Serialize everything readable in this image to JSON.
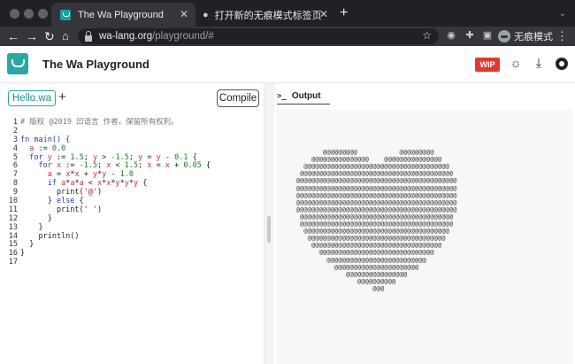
{
  "browser": {
    "tabs": [
      {
        "title": "The Wa Playground",
        "icon": "wa-favicon-icon"
      },
      {
        "title": "打开新的无痕模式标签页",
        "icon": "incognito-icon"
      }
    ],
    "url_host": "wa-lang.org",
    "url_path": "/playground/#",
    "profile_label": "无痕模式"
  },
  "app": {
    "title": "The Wa Playground",
    "badge": "WIP",
    "accent_color": "#27a9a3",
    "badge_color": "#e03a2f"
  },
  "editor": {
    "file_tab": "Hello.wa",
    "add_label": "+",
    "compile_label": "Compile",
    "code": [
      [
        {
          "t": "# 版权 @2019 凹语言 作者。保留所有权利。",
          "c": "cm"
        }
      ],
      [],
      [
        {
          "t": "fn main() {",
          "c": "kw"
        }
      ],
      [
        {
          "t": "  "
        },
        {
          "t": "a",
          "c": "vr"
        },
        {
          "t": " := "
        },
        {
          "t": "0.0",
          "c": "nm"
        }
      ],
      [
        {
          "t": "  for ",
          "c": "kw"
        },
        {
          "t": "y",
          "c": "vr"
        },
        {
          "t": " := "
        },
        {
          "t": "1.5",
          "c": "nm"
        },
        {
          "t": "; "
        },
        {
          "t": "y",
          "c": "vr"
        },
        {
          "t": " > "
        },
        {
          "t": "-1.5",
          "c": "nm"
        },
        {
          "t": "; "
        },
        {
          "t": "y",
          "c": "vr"
        },
        {
          "t": " = "
        },
        {
          "t": "y",
          "c": "vr"
        },
        {
          "t": " - "
        },
        {
          "t": "0.1",
          "c": "nm"
        },
        {
          "t": " {"
        }
      ],
      [
        {
          "t": "    for ",
          "c": "kw"
        },
        {
          "t": "x",
          "c": "vr"
        },
        {
          "t": " := "
        },
        {
          "t": "-1.5",
          "c": "nm"
        },
        {
          "t": "; "
        },
        {
          "t": "x",
          "c": "vr"
        },
        {
          "t": " < "
        },
        {
          "t": "1.5",
          "c": "nm"
        },
        {
          "t": "; "
        },
        {
          "t": "x",
          "c": "vr"
        },
        {
          "t": " = "
        },
        {
          "t": "x",
          "c": "vr"
        },
        {
          "t": " + "
        },
        {
          "t": "0.05",
          "c": "nm"
        },
        {
          "t": " {"
        }
      ],
      [
        {
          "t": "      "
        },
        {
          "t": "a",
          "c": "vr"
        },
        {
          "t": " = "
        },
        {
          "t": "x",
          "c": "vr"
        },
        {
          "t": "*"
        },
        {
          "t": "x",
          "c": "vr"
        },
        {
          "t": " + "
        },
        {
          "t": "y",
          "c": "vr"
        },
        {
          "t": "*"
        },
        {
          "t": "y",
          "c": "vr"
        },
        {
          "t": " - "
        },
        {
          "t": "1.0",
          "c": "nm"
        }
      ],
      [
        {
          "t": "      if ",
          "c": "kw"
        },
        {
          "t": "a",
          "c": "vr"
        },
        {
          "t": "*"
        },
        {
          "t": "a",
          "c": "vr"
        },
        {
          "t": "*"
        },
        {
          "t": "a",
          "c": "vr"
        },
        {
          "t": " < "
        },
        {
          "t": "x",
          "c": "vr"
        },
        {
          "t": "*"
        },
        {
          "t": "x",
          "c": "vr"
        },
        {
          "t": "*"
        },
        {
          "t": "y",
          "c": "vr"
        },
        {
          "t": "*"
        },
        {
          "t": "y",
          "c": "vr"
        },
        {
          "t": "*"
        },
        {
          "t": "y",
          "c": "vr"
        },
        {
          "t": " {"
        }
      ],
      [
        {
          "t": "        print("
        },
        {
          "t": "'@'",
          "c": "st"
        },
        {
          "t": ")"
        }
      ],
      [
        {
          "t": "      } "
        },
        {
          "t": "else",
          "c": "kw"
        },
        {
          "t": " {"
        }
      ],
      [
        {
          "t": "        print("
        },
        {
          "t": "' '",
          "c": "st"
        },
        {
          "t": ")"
        }
      ],
      [
        {
          "t": "      }"
        }
      ],
      [
        {
          "t": "    }"
        }
      ],
      [
        {
          "t": "    println()"
        }
      ],
      [
        {
          "t": "  }"
        }
      ],
      [
        {
          "t": "}"
        }
      ],
      []
    ]
  },
  "output": {
    "tab_label": "Output",
    "prompt_glyph": ">_",
    "lines": [
      "",
      "            @@@@@@@@@           @@@@@@@@@",
      "         @@@@@@@@@@@@@@@    @@@@@@@@@@@@@@@",
      "       @@@@@@@@@@@@@@@@@@@@@@@@@@@@@@@@@@@@@@",
      "      @@@@@@@@@@@@@@@@@@@@@@@@@@@@@@@@@@@@@@@@",
      "     @@@@@@@@@@@@@@@@@@@@@@@@@@@@@@@@@@@@@@@@@@",
      "     @@@@@@@@@@@@@@@@@@@@@@@@@@@@@@@@@@@@@@@@@@",
      "     @@@@@@@@@@@@@@@@@@@@@@@@@@@@@@@@@@@@@@@@@@",
      "     @@@@@@@@@@@@@@@@@@@@@@@@@@@@@@@@@@@@@@@@@@",
      "     @@@@@@@@@@@@@@@@@@@@@@@@@@@@@@@@@@@@@@@@@@",
      "      @@@@@@@@@@@@@@@@@@@@@@@@@@@@@@@@@@@@@@@@",
      "      @@@@@@@@@@@@@@@@@@@@@@@@@@@@@@@@@@@@@@@@",
      "       @@@@@@@@@@@@@@@@@@@@@@@@@@@@@@@@@@@@@@",
      "        @@@@@@@@@@@@@@@@@@@@@@@@@@@@@@@@@@@@",
      "         @@@@@@@@@@@@@@@@@@@@@@@@@@@@@@@@@@",
      "           @@@@@@@@@@@@@@@@@@@@@@@@@@@@@@",
      "             @@@@@@@@@@@@@@@@@@@@@@@@@@",
      "               @@@@@@@@@@@@@@@@@@@@@@",
      "                  @@@@@@@@@@@@@@@@",
      "                     @@@@@@@@@@",
      "                         @@@",
      ""
    ]
  }
}
